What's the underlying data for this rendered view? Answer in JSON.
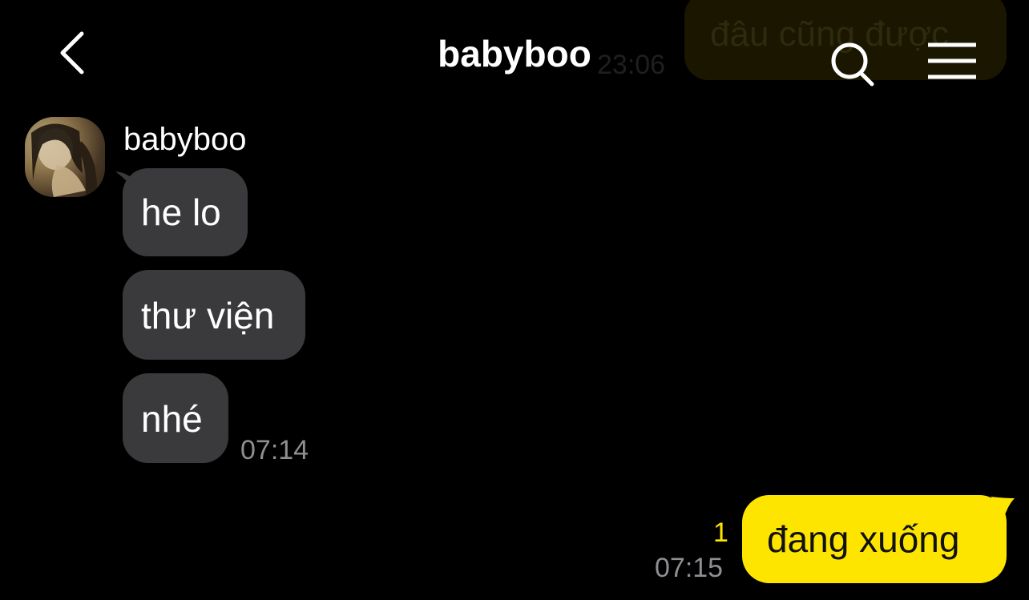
{
  "header": {
    "title": "babyboo",
    "back_icon": "chevron-left-icon",
    "search_icon": "search-icon",
    "menu_icon": "hamburger-menu-icon"
  },
  "previous_message": {
    "text": "đâu cũng được",
    "time": "23:06"
  },
  "conversation": {
    "sender_name": "babyboo",
    "received": [
      {
        "text": "he lo"
      },
      {
        "text": "thư viện"
      },
      {
        "text": "nhé"
      }
    ],
    "received_time": "07:14",
    "sent": {
      "text": "đang xuống",
      "unread_count": "1",
      "time": "07:15"
    }
  },
  "colors": {
    "background": "#000000",
    "received_bubble": "#3a3a3c",
    "sent_bubble": "#fee500",
    "timestamp": "#8e8e93",
    "unread": "#fee500"
  }
}
